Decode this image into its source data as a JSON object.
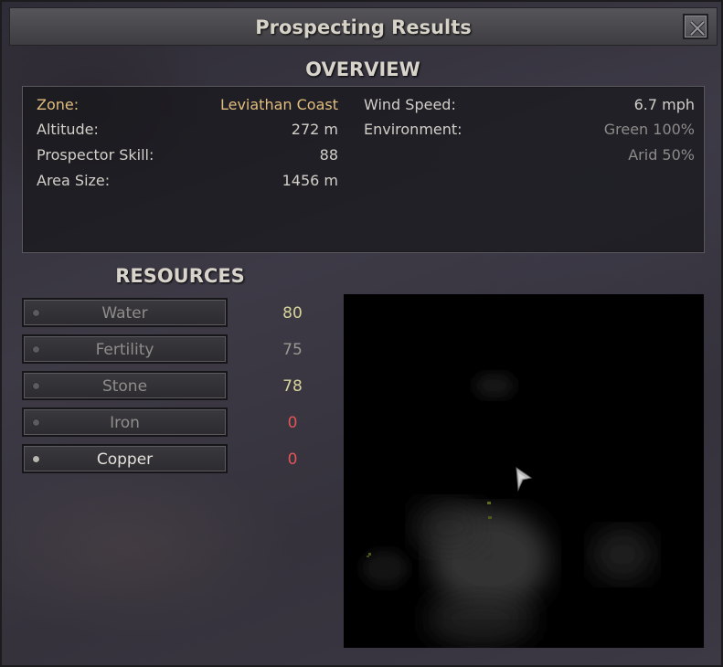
{
  "window": {
    "title": "Prospecting Results"
  },
  "overview": {
    "heading": "OVERVIEW",
    "left": [
      {
        "label": "Zone:",
        "value": "Leviathan Coast"
      },
      {
        "label": "Altitude:",
        "value": "272 m"
      },
      {
        "label": "Prospector Skill:",
        "value": "88"
      },
      {
        "label": "Area Size:",
        "value": "1456 m"
      }
    ],
    "wind": {
      "label": "Wind Speed:",
      "value": "6.7 mph"
    },
    "environment": {
      "label": "Environment:",
      "values": [
        "Green 100%",
        "Arid 50%"
      ]
    }
  },
  "resources": {
    "heading": "RESOURCES",
    "items": [
      {
        "label": "Water",
        "value": "80",
        "color": "#d8d49a"
      },
      {
        "label": "Fertility",
        "value": "75",
        "color": "#9a9892"
      },
      {
        "label": "Stone",
        "value": "78",
        "color": "#d8d49a"
      },
      {
        "label": "Iron",
        "value": "0",
        "color": "#e05555"
      },
      {
        "label": "Copper",
        "value": "0",
        "color": "#e05555",
        "selected": true
      }
    ]
  },
  "map": {
    "cursor_icon": "arrow-cursor-icon"
  }
}
